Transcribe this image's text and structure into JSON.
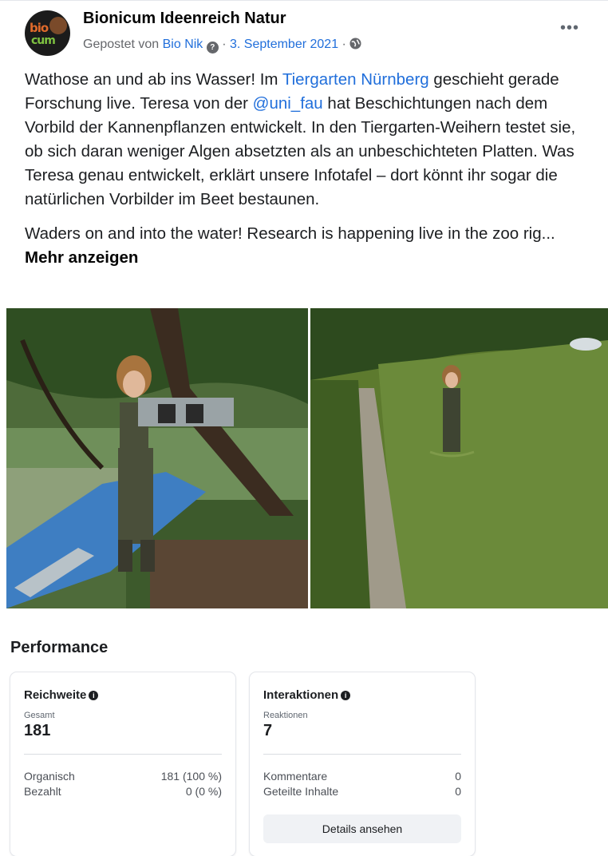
{
  "post": {
    "page_name": "Bionicum Ideenreich Natur",
    "avatar_text_1": "bio",
    "avatar_text_2": "cum",
    "posted_by_prefix": "Gepostet von",
    "author": "Bio Nik",
    "separator": "·",
    "date": "3. September 2021",
    "more_options": "•••",
    "text_de_1": "Wathose an und ab ins Wasser! Im ",
    "text_de_link1": "Tiergarten Nürnberg",
    "text_de_2": " geschieht gerade Forschung live. Teresa von der ",
    "text_de_link2": "@uni_fau",
    "text_de_3": "  hat Beschichtungen nach dem Vorbild der Kannenpflanzen entwickelt. In den Tiergarten-Weihern testet sie, ob sich daran weniger Algen absetzten als an unbeschichteten Platten. Was Teresa genau entwickelt, erklärt unsere Infotafel – dort könnt ihr sogar die natürlichen Vorbilder im Beet bestaunen.",
    "text_en": "Waders on and into the water! Research is happening live in the zoo rig... ",
    "see_more": "Mehr anzeigen"
  },
  "performance": {
    "title": "Performance",
    "reach": {
      "title": "Reichweite",
      "total_label": "Gesamt",
      "total_value": "181",
      "rows": [
        {
          "label": "Organisch",
          "value": "181 (100 %)"
        },
        {
          "label": "Bezahlt",
          "value": "0 (0 %)"
        }
      ]
    },
    "interactions": {
      "title": "Interaktionen",
      "reactions_label": "Reaktionen",
      "reactions_value": "7",
      "rows": [
        {
          "label": "Kommentare",
          "value": "0"
        },
        {
          "label": "Geteilte Inhalte",
          "value": "0"
        }
      ],
      "details_button": "Details ansehen"
    }
  },
  "colors": {
    "link": "#216fdb",
    "text": "#1c1e21",
    "secondary": "#65676b"
  }
}
